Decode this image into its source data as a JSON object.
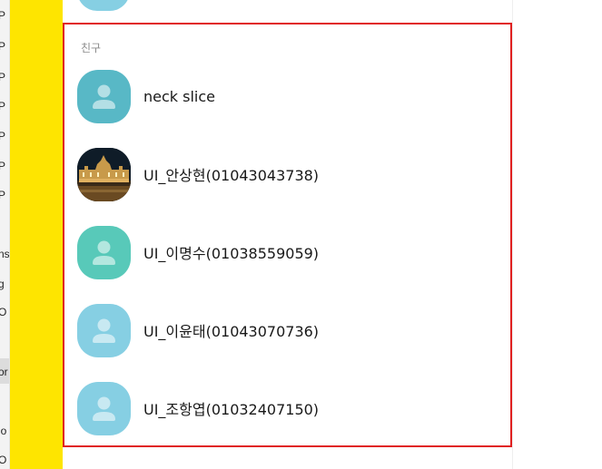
{
  "background_app": {
    "fragments": [
      "P",
      "P",
      "P",
      "P",
      "P",
      "P",
      "P",
      "ns",
      "g",
      "O",
      "or",
      "lo",
      "O"
    ]
  },
  "friends": {
    "section_title": "친구",
    "items": [
      {
        "name": "neck slice",
        "avatar": "default-profile-icon",
        "color": "#58b8c6"
      },
      {
        "name": "UI_안상현(01043043738)",
        "avatar": "photo-parliament-night",
        "color": "#10202c"
      },
      {
        "name": "UI_이명수(01038559059)",
        "avatar": "default-profile-icon",
        "color": "#58c9b9"
      },
      {
        "name": "UI_이윤태(01043070736)",
        "avatar": "default-profile-icon",
        "color": "#86cfe3"
      },
      {
        "name": "UI_조항엽(01032407150)",
        "avatar": "default-profile-icon",
        "color": "#86cfe3"
      }
    ]
  },
  "colors": {
    "rail": "#fee500",
    "highlight_border": "#e02020"
  }
}
